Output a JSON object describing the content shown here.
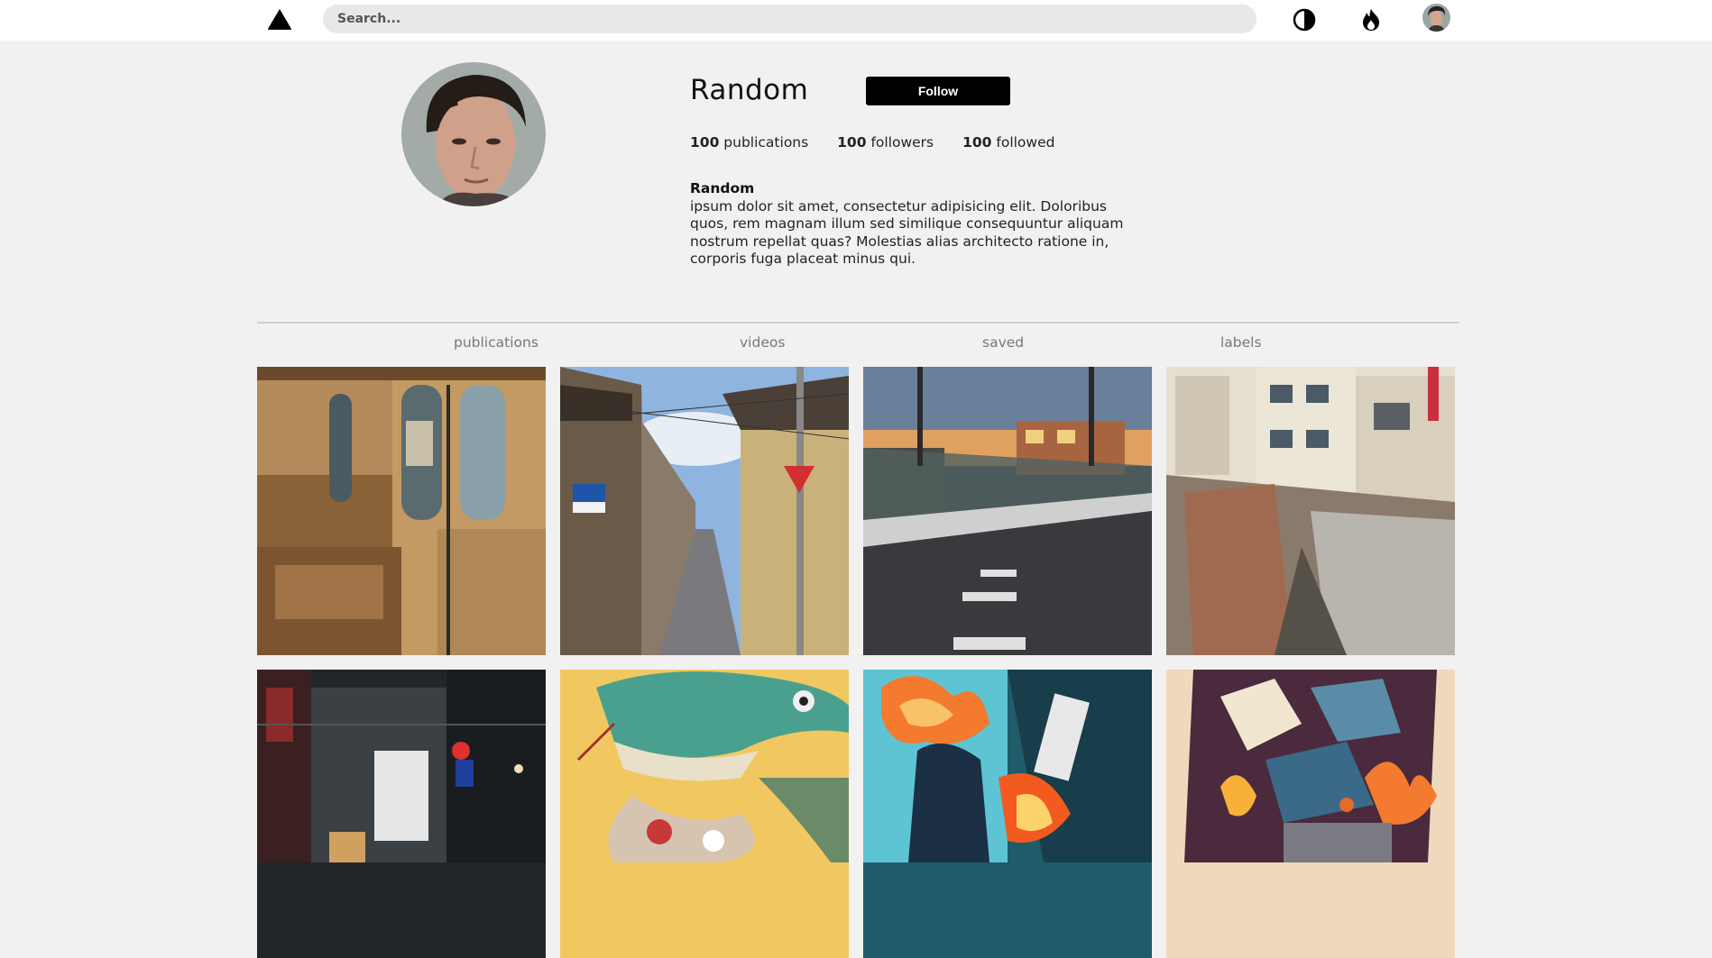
{
  "header": {
    "logo_icon": "triangle-logo-icon",
    "search_placeholder": "Search...",
    "icons": [
      "theme-toggle-icon",
      "fire-icon",
      "user-avatar"
    ]
  },
  "profile": {
    "username": "Random",
    "follow_label": "Follow",
    "stats": [
      {
        "count": "100",
        "label": "publications"
      },
      {
        "count": "100",
        "label": "followers"
      },
      {
        "count": "100",
        "label": "followed"
      }
    ],
    "bio_name": "Random",
    "bio_text": "ipsum dolor sit amet, consectetur adipisicing elit. Doloribus quos, rem magnam illum sed similique consequuntur aliquam nostrum repellat quas? Molestias alias architecto ratione in, corporis fuga placeat minus qui."
  },
  "tabs": [
    "publications",
    "videos",
    "saved",
    "labels"
  ],
  "gallery": [
    {
      "name": "train-interior-photo"
    },
    {
      "name": "street-alley-photo"
    },
    {
      "name": "railway-road-photo"
    },
    {
      "name": "cliff-buildings-photo"
    },
    {
      "name": "night-alley-photo"
    },
    {
      "name": "crocodile-illustration"
    },
    {
      "name": "explosion-illustration"
    },
    {
      "name": "battle-illustration"
    }
  ],
  "colors": {
    "background": "#f1f1f1",
    "topbar": "#ffffff",
    "button": "#000000",
    "tab_text": "#777777"
  }
}
